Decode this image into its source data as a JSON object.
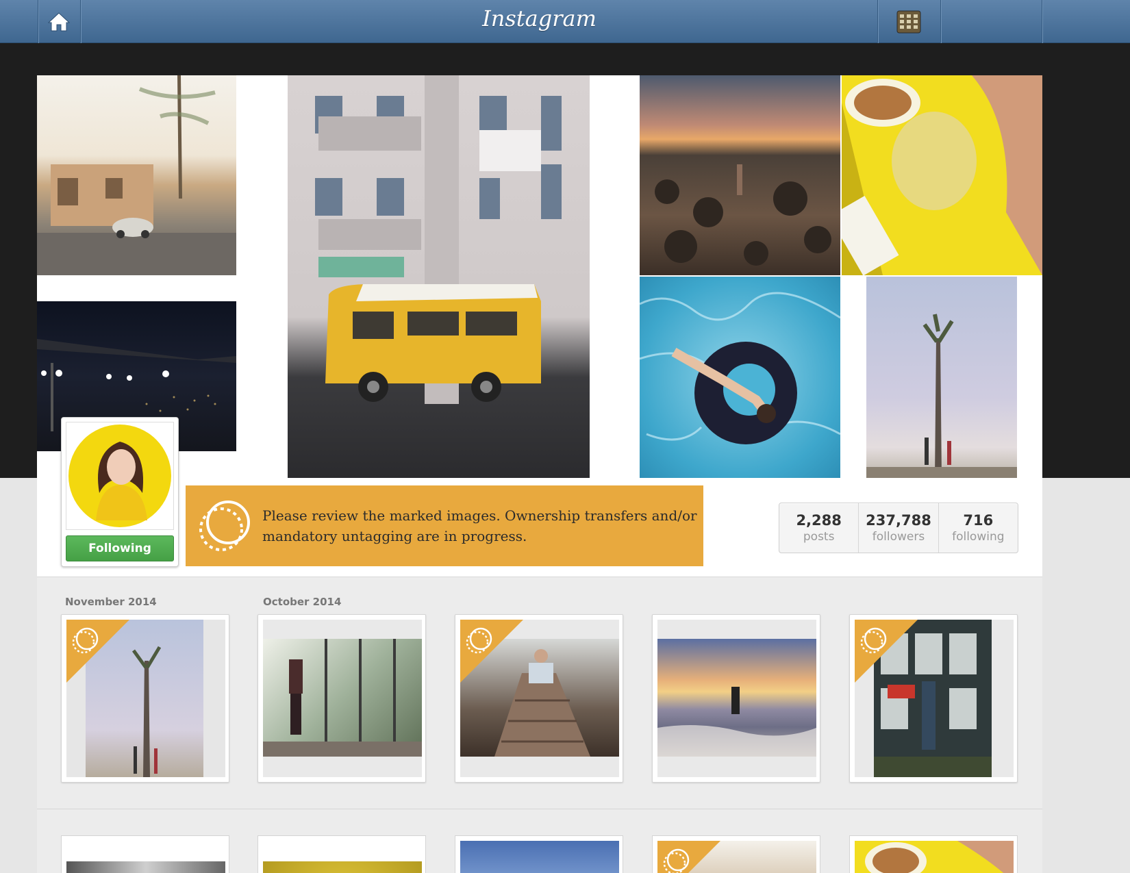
{
  "topbar": {
    "brand": "Instagram",
    "home_icon": "home-icon",
    "grid_icon": "grid-view-icon"
  },
  "profile": {
    "follow_button": "Following"
  },
  "banner": {
    "icon": "ownership-transfer-icon",
    "message": "Please review the marked images. Ownership transfers and/or mandatory untagging are in progress."
  },
  "stats": [
    {
      "value": "2,288",
      "label": "posts"
    },
    {
      "value": "237,788",
      "label": "followers"
    },
    {
      "value": "716",
      "label": "following"
    }
  ],
  "feed": {
    "months": [
      "November 2014",
      "October 2014"
    ]
  },
  "colors": {
    "topbar": "#4a7098",
    "banner": "#e8a93e",
    "follow_button": "#4fab4f",
    "ribbon": "#e8a93e"
  }
}
